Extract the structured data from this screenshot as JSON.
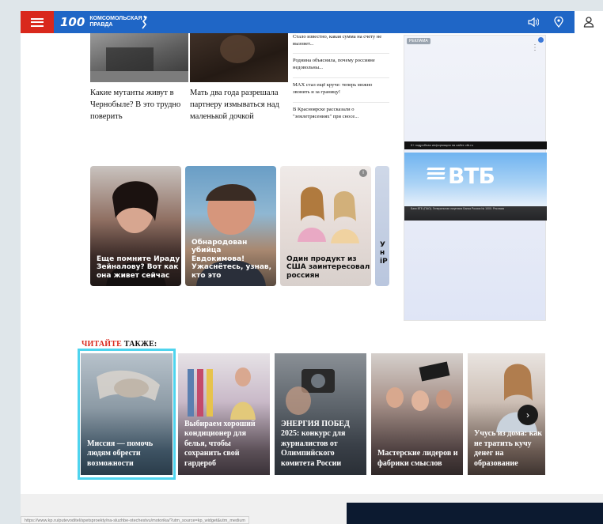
{
  "header": {
    "logo_number": "100",
    "logo_line1": "Комсомольская",
    "logo_line2": "правда"
  },
  "top_cards": [
    {
      "title": "Какие мутанты живут в Чернобыле? В это трудно поверить"
    },
    {
      "title": "Мать два года разрешала партнеру измываться над маленькой дочкой"
    }
  ],
  "news_list": [
    {
      "title": "Стало известно, какая сумма на счету не вызовет..."
    },
    {
      "title": "Роднина объяснила, почему россияне недовольны..."
    },
    {
      "title": "MAX стал ещё круче: теперь можно звонить и за границу!"
    },
    {
      "title": "В Красноярске рассказали о \"землетрясениях\" при сносе..."
    }
  ],
  "ad": {
    "label": "РЕКЛАМА",
    "brand": "ВТБ",
    "strip_text": "0+ подробная информация на сайте vtb.ru",
    "ticker_text": "Банк ВТБ (ПАО). Генеральная лицензия Банка России № 1000. Реклама"
  },
  "promos": [
    {
      "text": "Еще помните Ираду Зейналову? Вот как она живет сейчас"
    },
    {
      "text": "Обнародован убийца Евдокимова! Ужаснётесь, узнав, кто это"
    },
    {
      "text": "Один продукт из США заинтересовал россиян"
    },
    {
      "text": "У н iP"
    }
  ],
  "read_also": {
    "heading_red": "ЧИТАЙТЕ",
    "heading_black": " ТАКЖЕ:",
    "cards": [
      {
        "title": "Миссия — помочь людям обрести возможности"
      },
      {
        "title": "Выбираем хороший кондиционер для белья, чтобы сохранить свой гардероб"
      },
      {
        "title": "ЭНЕРГИЯ ПОБЕД 2025: конкурс для журналистов от Олимпийского комитета России"
      },
      {
        "title": "Мастерские лидеров и фабрики смыслов"
      },
      {
        "title": "Учусь из дома: как не тратить кучу денег на образование"
      }
    ]
  },
  "status_url": "https://www.kp.ru/putevoditel/spetsproekty/na-sluzhbe-otechestvu/motorika/?utm_source=kp_widget&utm_medium",
  "colors": {
    "header_blue": "#1f66c6",
    "menu_red": "#d9281c",
    "selection_cyan": "#4fd4ee"
  },
  "icons": {
    "menu": "hamburger-icon",
    "sound": "speaker-icon",
    "location": "location-pin-icon",
    "user": "user-icon",
    "next": "chevron-right-icon"
  }
}
